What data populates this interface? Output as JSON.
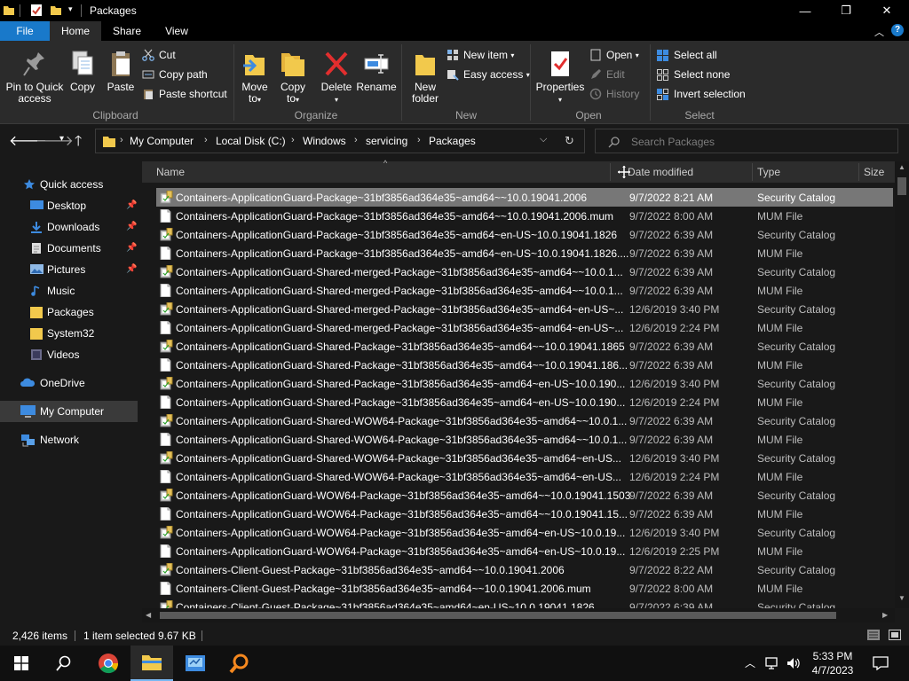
{
  "window": {
    "title": "Packages",
    "controls": {
      "minimize": "—",
      "maximize": "❐",
      "close": "✕"
    }
  },
  "ribbon_tabs": [
    {
      "label": "File"
    },
    {
      "label": "Home"
    },
    {
      "label": "Share"
    },
    {
      "label": "View"
    }
  ],
  "ribbon": {
    "clipboard": {
      "pin_label": "Pin to Quick\naccess",
      "copy_label": "Copy",
      "paste_label": "Paste",
      "cut_label": "Cut",
      "copy_path_label": "Copy path",
      "paste_shortcut_label": "Paste shortcut",
      "group_label": "Clipboard"
    },
    "organize": {
      "move_to_label": "Move\nto",
      "copy_to_label": "Copy\nto",
      "delete_label": "Delete",
      "rename_label": "Rename",
      "group_label": "Organize"
    },
    "new": {
      "new_folder_label": "New\nfolder",
      "new_item_label": "New item",
      "easy_access_label": "Easy access",
      "group_label": "New"
    },
    "open": {
      "properties_label": "Properties",
      "open_label": "Open",
      "edit_label": "Edit",
      "history_label": "History",
      "group_label": "Open"
    },
    "select": {
      "select_all_label": "Select all",
      "select_none_label": "Select none",
      "invert_selection_label": "Invert selection",
      "group_label": "Select"
    }
  },
  "address": {
    "breadcrumbs": [
      "My Computer",
      "Local Disk (C:)",
      "Windows",
      "servicing",
      "Packages"
    ],
    "search_placeholder": "Search Packages"
  },
  "nav_pane": {
    "items": [
      {
        "label": "Quick access",
        "icon": "star-icon",
        "pinned": false
      },
      {
        "label": "Desktop",
        "icon": "desktop-icon",
        "pinned": true
      },
      {
        "label": "Downloads",
        "icon": "download-icon",
        "pinned": true
      },
      {
        "label": "Documents",
        "icon": "documents-icon",
        "pinned": true
      },
      {
        "label": "Pictures",
        "icon": "pictures-icon",
        "pinned": true
      },
      {
        "label": "Music",
        "icon": "music-icon",
        "pinned": false
      },
      {
        "label": "Packages",
        "icon": "folder-icon",
        "pinned": false
      },
      {
        "label": "System32",
        "icon": "folder-icon",
        "pinned": false
      },
      {
        "label": "Videos",
        "icon": "videos-icon",
        "pinned": false
      },
      {
        "label": "OneDrive",
        "icon": "cloud-icon",
        "pinned": false
      },
      {
        "label": "My Computer",
        "icon": "computer-icon",
        "pinned": false
      },
      {
        "label": "Network",
        "icon": "network-icon",
        "pinned": false
      }
    ],
    "pin_glyph": "📌"
  },
  "columns": {
    "name": "Name",
    "date": "Date modified",
    "type": "Type",
    "size": "Size"
  },
  "files": [
    {
      "name": "Containers-ApplicationGuard-Package~31bf3856ad364e35~amd64~~10.0.19041.2006",
      "date": "9/7/2022 8:21 AM",
      "type": "Security Catalog",
      "kind": "cat"
    },
    {
      "name": "Containers-ApplicationGuard-Package~31bf3856ad364e35~amd64~~10.0.19041.2006.mum",
      "date": "9/7/2022 8:00 AM",
      "type": "MUM File",
      "kind": "mum"
    },
    {
      "name": "Containers-ApplicationGuard-Package~31bf3856ad364e35~amd64~en-US~10.0.19041.1826",
      "date": "9/7/2022 6:39 AM",
      "type": "Security Catalog",
      "kind": "cat"
    },
    {
      "name": "Containers-ApplicationGuard-Package~31bf3856ad364e35~amd64~en-US~10.0.19041.1826....",
      "date": "9/7/2022 6:39 AM",
      "type": "MUM File",
      "kind": "mum"
    },
    {
      "name": "Containers-ApplicationGuard-Shared-merged-Package~31bf3856ad364e35~amd64~~10.0.1...",
      "date": "9/7/2022 6:39 AM",
      "type": "Security Catalog",
      "kind": "cat"
    },
    {
      "name": "Containers-ApplicationGuard-Shared-merged-Package~31bf3856ad364e35~amd64~~10.0.1...",
      "date": "9/7/2022 6:39 AM",
      "type": "MUM File",
      "kind": "mum"
    },
    {
      "name": "Containers-ApplicationGuard-Shared-merged-Package~31bf3856ad364e35~amd64~en-US~...",
      "date": "12/6/2019 3:40 PM",
      "type": "Security Catalog",
      "kind": "cat"
    },
    {
      "name": "Containers-ApplicationGuard-Shared-merged-Package~31bf3856ad364e35~amd64~en-US~...",
      "date": "12/6/2019 2:24 PM",
      "type": "MUM File",
      "kind": "mum"
    },
    {
      "name": "Containers-ApplicationGuard-Shared-Package~31bf3856ad364e35~amd64~~10.0.19041.1865",
      "date": "9/7/2022 6:39 AM",
      "type": "Security Catalog",
      "kind": "cat"
    },
    {
      "name": "Containers-ApplicationGuard-Shared-Package~31bf3856ad364e35~amd64~~10.0.19041.186...",
      "date": "9/7/2022 6:39 AM",
      "type": "MUM File",
      "kind": "mum"
    },
    {
      "name": "Containers-ApplicationGuard-Shared-Package~31bf3856ad364e35~amd64~en-US~10.0.190...",
      "date": "12/6/2019 3:40 PM",
      "type": "Security Catalog",
      "kind": "cat"
    },
    {
      "name": "Containers-ApplicationGuard-Shared-Package~31bf3856ad364e35~amd64~en-US~10.0.190...",
      "date": "12/6/2019 2:24 PM",
      "type": "MUM File",
      "kind": "mum"
    },
    {
      "name": "Containers-ApplicationGuard-Shared-WOW64-Package~31bf3856ad364e35~amd64~~10.0.1...",
      "date": "9/7/2022 6:39 AM",
      "type": "Security Catalog",
      "kind": "cat"
    },
    {
      "name": "Containers-ApplicationGuard-Shared-WOW64-Package~31bf3856ad364e35~amd64~~10.0.1...",
      "date": "9/7/2022 6:39 AM",
      "type": "MUM File",
      "kind": "mum"
    },
    {
      "name": "Containers-ApplicationGuard-Shared-WOW64-Package~31bf3856ad364e35~amd64~en-US...",
      "date": "12/6/2019 3:40 PM",
      "type": "Security Catalog",
      "kind": "cat"
    },
    {
      "name": "Containers-ApplicationGuard-Shared-WOW64-Package~31bf3856ad364e35~amd64~en-US...",
      "date": "12/6/2019 2:24 PM",
      "type": "MUM File",
      "kind": "mum"
    },
    {
      "name": "Containers-ApplicationGuard-WOW64-Package~31bf3856ad364e35~amd64~~10.0.19041.1503",
      "date": "9/7/2022 6:39 AM",
      "type": "Security Catalog",
      "kind": "cat"
    },
    {
      "name": "Containers-ApplicationGuard-WOW64-Package~31bf3856ad364e35~amd64~~10.0.19041.15...",
      "date": "9/7/2022 6:39 AM",
      "type": "MUM File",
      "kind": "mum"
    },
    {
      "name": "Containers-ApplicationGuard-WOW64-Package~31bf3856ad364e35~amd64~en-US~10.0.19...",
      "date": "12/6/2019 3:40 PM",
      "type": "Security Catalog",
      "kind": "cat"
    },
    {
      "name": "Containers-ApplicationGuard-WOW64-Package~31bf3856ad364e35~amd64~en-US~10.0.19...",
      "date": "12/6/2019 2:25 PM",
      "type": "MUM File",
      "kind": "mum"
    },
    {
      "name": "Containers-Client-Guest-Package~31bf3856ad364e35~amd64~~10.0.19041.2006",
      "date": "9/7/2022 8:22 AM",
      "type": "Security Catalog",
      "kind": "cat"
    },
    {
      "name": "Containers-Client-Guest-Package~31bf3856ad364e35~amd64~~10.0.19041.2006.mum",
      "date": "9/7/2022 8:00 AM",
      "type": "MUM File",
      "kind": "mum"
    },
    {
      "name": "Containers-Client-Guest-Package~31bf3856ad364e35~amd64~en-US~10.0.19041.1826",
      "date": "9/7/2022 6:39 AM",
      "type": "Security Catalog",
      "kind": "cat"
    }
  ],
  "selected_index": 0,
  "status": {
    "item_count": "2,426 items",
    "selected": "1 item selected",
    "size": "9.67 KB"
  },
  "taskbar": {
    "apps": [
      "start-icon",
      "search-icon",
      "chrome-icon",
      "file-explorer-icon",
      "control-panel-icon",
      "magnifier-icon"
    ],
    "time": "5:33 PM",
    "date": "4/7/2023"
  },
  "colors": {
    "accent": "#1979ca",
    "folder": "#f2c94c",
    "selection": "#777777"
  }
}
